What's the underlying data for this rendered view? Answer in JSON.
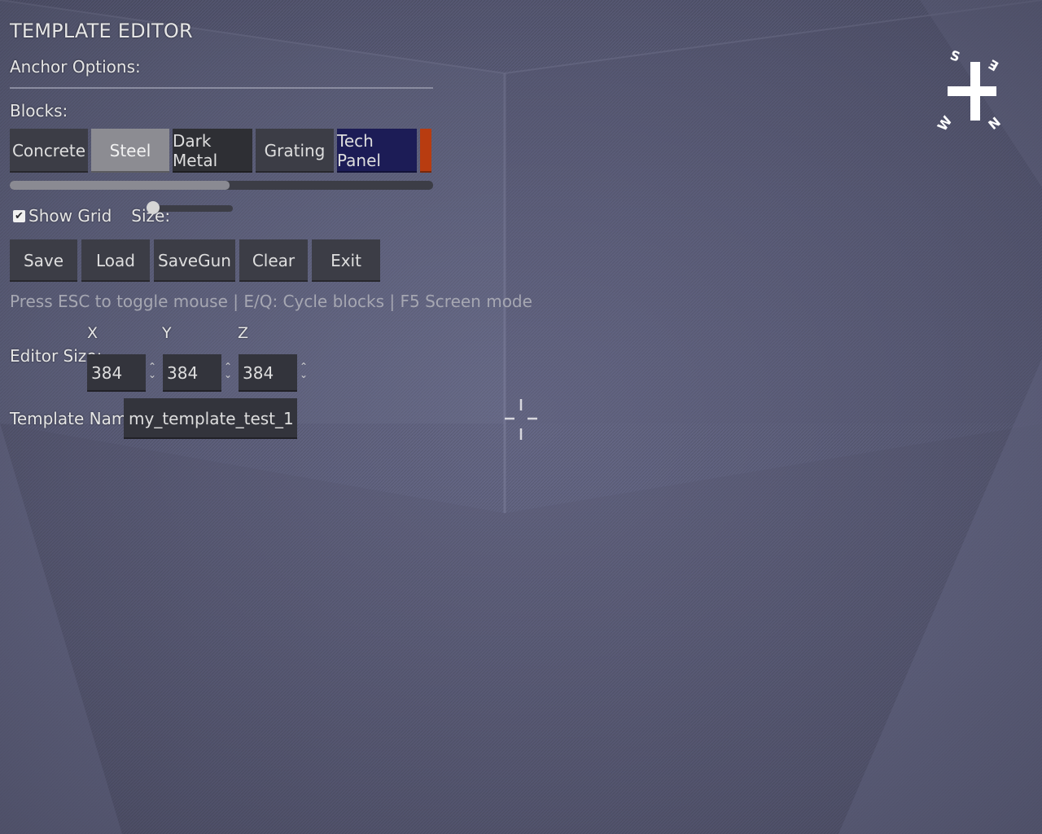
{
  "header": {
    "title": "TEMPLATE EDITOR",
    "anchor_label": "Anchor Options:",
    "blocks_label": "Blocks:"
  },
  "blocks": {
    "items": [
      {
        "label": "Concrete",
        "bg": "#3c3d46",
        "selected": false
      },
      {
        "label": "Steel",
        "bg": "#8c8c92",
        "selected": true
      },
      {
        "label": "Dark Metal",
        "bg": "#2e2f34",
        "selected": false
      },
      {
        "label": "Grating",
        "bg": "#3c3d46",
        "selected": false
      },
      {
        "label": "Tech Panel",
        "bg": "#1c1c56",
        "selected": false
      },
      {
        "label": "",
        "bg": "#b83c10",
        "selected": false
      }
    ],
    "scroll_fraction": 0.52
  },
  "grid": {
    "show_label": "Show Grid",
    "checked": true,
    "size_label": "Size:",
    "size_fraction": 0.0
  },
  "buttons": [
    "Save",
    "Load",
    "SaveGun",
    "Clear",
    "Exit"
  ],
  "hint": "Press ESC to toggle mouse | E/Q: Cycle blocks | F5 Screen mode",
  "editor_size": {
    "label": "Editor Size:",
    "axes": [
      {
        "axis": "X",
        "value": "384"
      },
      {
        "axis": "Y",
        "value": "384"
      },
      {
        "axis": "Z",
        "value": "384"
      }
    ]
  },
  "template_name": {
    "label": "Template Name:",
    "value": "my_template_test_1"
  },
  "compass": {
    "labels": [
      "S",
      "E",
      "W",
      "N"
    ]
  },
  "colors": {
    "panel": "#3c3d46",
    "accent_orange": "#b83c10",
    "tech_panel_blue": "#1c1c56"
  }
}
